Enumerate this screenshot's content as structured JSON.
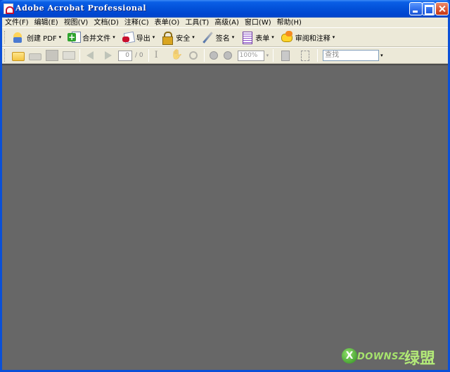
{
  "window": {
    "title": "Adobe Acrobat Professional",
    "controls": [
      "minimize",
      "maximize",
      "close"
    ]
  },
  "menubar": {
    "items": [
      "文件(F)",
      "编辑(E)",
      "视图(V)",
      "文档(D)",
      "注释(C)",
      "表单(O)",
      "工具(T)",
      "高级(A)",
      "窗口(W)",
      "帮助(H)"
    ]
  },
  "toolbar1": {
    "buttons": [
      {
        "label": "创建 PDF",
        "icon": "create-pdf-icon"
      },
      {
        "label": "合并文件",
        "icon": "merge-files-icon"
      },
      {
        "label": "导出",
        "icon": "export-icon"
      },
      {
        "label": "安全",
        "icon": "lock-icon"
      },
      {
        "label": "签名",
        "icon": "pen-icon"
      },
      {
        "label": "表单",
        "icon": "form-icon"
      },
      {
        "label": "审阅和注释",
        "icon": "review-comment-icon"
      }
    ],
    "dropdown_arrow": "▾"
  },
  "toolbar2": {
    "page_current": "0",
    "page_total": "/ 0",
    "zoom": "100%",
    "search_placeholder": "查找",
    "dropdown_arrow": "▾"
  },
  "colors": {
    "titlebar": "#0a50d8",
    "chrome": "#ece9d8",
    "document_area": "#676767",
    "watermark_green": "#a6e36d"
  },
  "watermark": {
    "brand": "DOWNSZ",
    "glyphs": "绿盟"
  }
}
